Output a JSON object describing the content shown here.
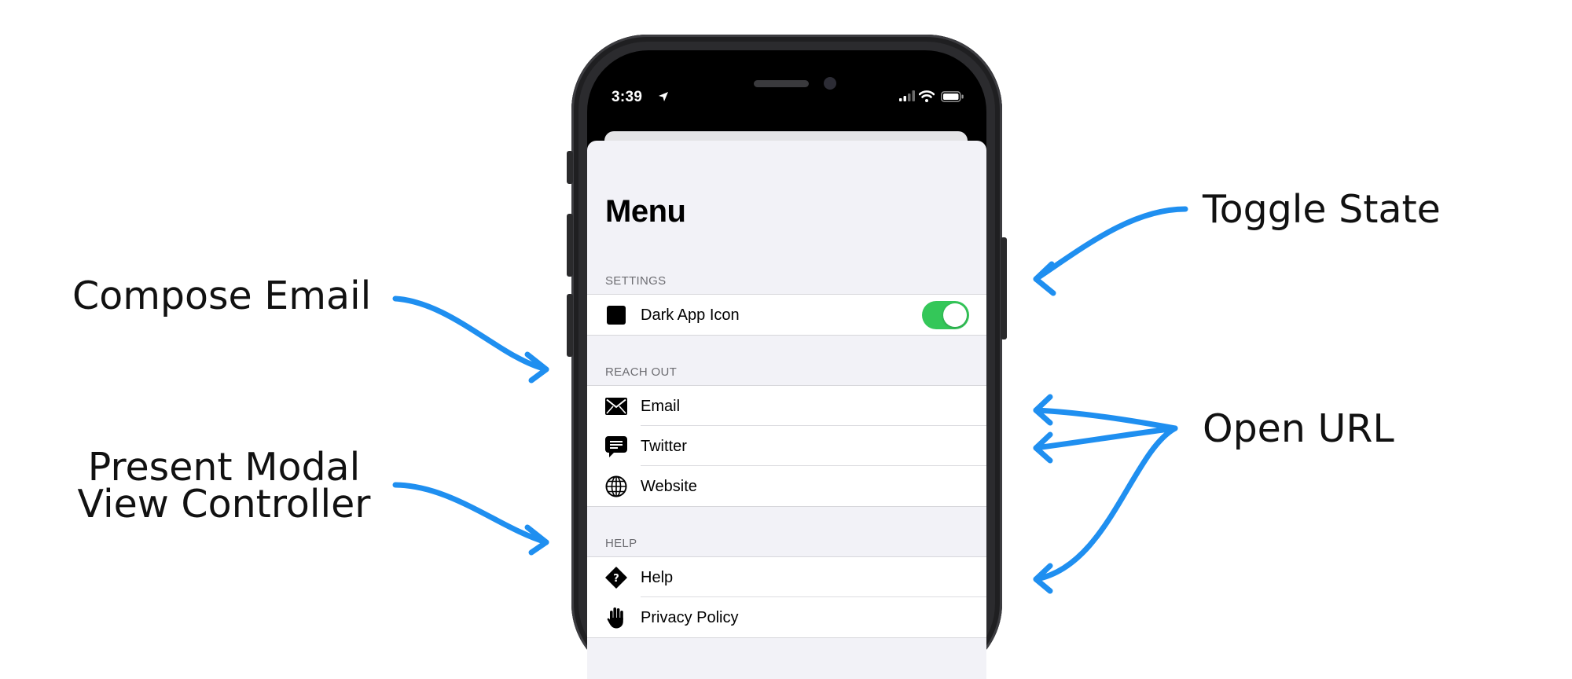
{
  "annotations": {
    "compose_email": "Compose Email",
    "present_modal_line1": "Present Modal",
    "present_modal_line2": "View Controller",
    "toggle_state": "Toggle State",
    "open_url": "Open URL"
  },
  "status_bar": {
    "time": "3:39"
  },
  "menu": {
    "title": "Menu",
    "sections": {
      "settings": {
        "header": "SETTINGS",
        "dark_icon_label": "Dark App Icon",
        "dark_icon_toggle_on": true
      },
      "reach_out": {
        "header": "REACH OUT",
        "email_label": "Email",
        "twitter_label": "Twitter",
        "website_label": "Website"
      },
      "help": {
        "header": "HELP",
        "help_label": "Help",
        "privacy_label": "Privacy Policy"
      }
    }
  },
  "colors": {
    "arrow": "#1f8ff0",
    "toggle_on": "#34c759",
    "grouped_background": "#f2f2f7"
  },
  "icons": [
    "location-arrow-icon",
    "signal-icon",
    "wifi-icon",
    "battery-icon",
    "app-icon-square",
    "envelope-icon",
    "speech-bubble-icon",
    "globe-icon",
    "help-diamond-icon",
    "hand-icon"
  ]
}
